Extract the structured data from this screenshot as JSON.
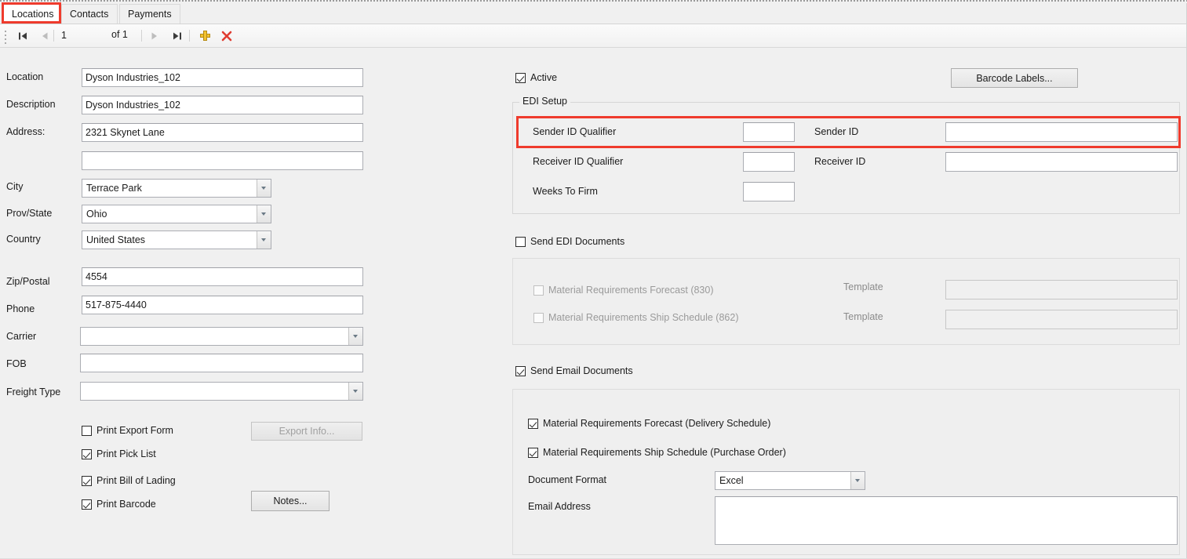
{
  "tabs": [
    {
      "label": "Locations",
      "active": true
    },
    {
      "label": "Contacts",
      "active": false
    },
    {
      "label": "Payments",
      "active": false
    }
  ],
  "navbar": {
    "first_icon": "first-record-icon",
    "prev_icon": "previous-record-icon",
    "current_record": "1",
    "of_label": "of 1",
    "next_icon": "next-record-icon",
    "last_icon": "last-record-icon",
    "add_icon": "add-record-icon",
    "delete_icon": "delete-record-icon"
  },
  "left": {
    "location_label": "Location",
    "location_value": "Dyson Industries_102",
    "description_label": "Description",
    "description_value": "Dyson Industries_102",
    "address_label": "Address:",
    "address_line1": "2321 Skynet Lane",
    "address_line2": "",
    "city_label": "City",
    "city_value": "Terrace Park",
    "prov_state_label": "Prov/State",
    "prov_state_value": "Ohio",
    "country_label": "Country",
    "country_value": "United States",
    "zip_label": "Zip/Postal",
    "zip_value": "4554",
    "phone_label": "Phone",
    "phone_value": "517-875-4440",
    "carrier_label": "Carrier",
    "carrier_value": "",
    "fob_label": "FOB",
    "fob_value": "",
    "freight_type_label": "Freight Type",
    "freight_type_value": "",
    "print_export_form_label": "Print Export Form",
    "print_export_form_checked": false,
    "print_pick_list_label": "Print Pick List",
    "print_pick_list_checked": true,
    "print_bill_of_lading_label": "Print Bill of Lading",
    "print_bill_of_lading_checked": true,
    "print_barcode_label": "Print Barcode",
    "print_barcode_checked": true,
    "export_info_button": "Export Info...",
    "notes_button": "Notes..."
  },
  "right": {
    "active_label": "Active",
    "active_checked": true,
    "barcode_labels_button": "Barcode Labels...",
    "edi_setup": {
      "title": "EDI Setup",
      "sender_id_qualifier_label": "Sender ID Qualifier",
      "sender_id_qualifier_value": "",
      "sender_id_label": "Sender ID",
      "sender_id_value": "",
      "receiver_id_qualifier_label": "Receiver ID Qualifier",
      "receiver_id_qualifier_value": "",
      "receiver_id_label": "Receiver ID",
      "receiver_id_value": "",
      "weeks_to_firm_label": "Weeks To Firm",
      "weeks_to_firm_value": ""
    },
    "send_edi_documents_label": "Send EDI Documents",
    "send_edi_documents_checked": false,
    "edi_docs": {
      "forecast_label": "Material Requirements Forecast (830)",
      "forecast_checked": false,
      "forecast_template_label": "Template",
      "forecast_template_value": "",
      "ship_schedule_label": "Material Requirements Ship Schedule (862)",
      "ship_schedule_checked": false,
      "ship_schedule_template_label": "Template",
      "ship_schedule_template_value": ""
    },
    "send_email_documents_label": "Send Email Documents",
    "send_email_documents_checked": true,
    "email_docs": {
      "forecast_label": "Material Requirements Forecast (Delivery Schedule)",
      "forecast_checked": true,
      "ship_schedule_label": "Material Requirements Ship Schedule (Purchase Order)",
      "ship_schedule_checked": true,
      "document_format_label": "Document Format",
      "document_format_value": "Excel",
      "email_address_label": "Email Address",
      "email_address_value": ""
    }
  },
  "colors": {
    "highlight": "#ef3b2d",
    "window_bg": "#f0f0f0",
    "add_icon": "#f2c230",
    "delete_icon": "#e03c31"
  }
}
